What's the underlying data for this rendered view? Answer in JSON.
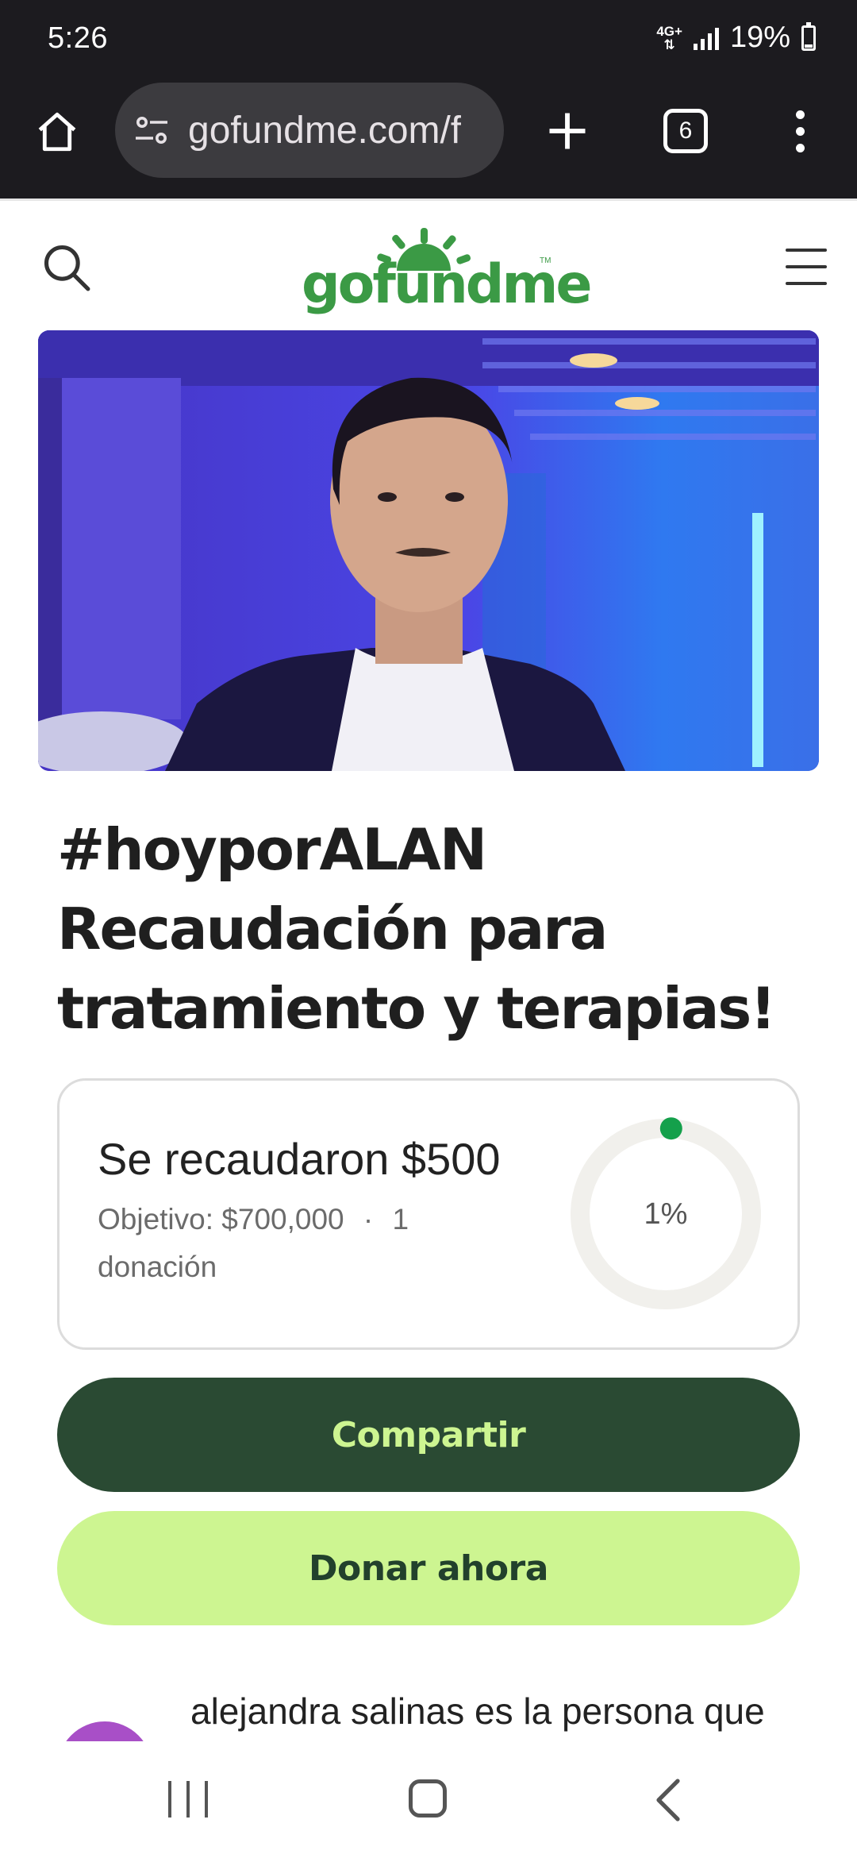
{
  "status_bar": {
    "time": "5:26",
    "network": "4G+",
    "battery": "19%"
  },
  "browser": {
    "url": "gofundme.com/f",
    "tab_count": "6",
    "icons": [
      "home-icon",
      "tune-icon",
      "plus-icon",
      "tabs-icon",
      "more-vert-icon"
    ]
  },
  "site": {
    "logo": "gofundme",
    "icons": [
      "search-icon",
      "menu-icon"
    ]
  },
  "campaign": {
    "title": "#hoyporALAN Recaudación para tratamiento y terapias!",
    "raised": "Se recaudaron $500",
    "goal": "Objetivo: $700,000",
    "separator": "·",
    "donations": "1 donación",
    "progress_label": "1%",
    "progress_fraction": 0.01
  },
  "actions": {
    "share": "Compartir",
    "donate": "Donar ahora"
  },
  "organizer": {
    "text": "alejandra salinas es la persona que"
  },
  "colors": {
    "brand_green": "#3b9a45",
    "share_bg": "#2a4a33",
    "share_text": "#cdf591",
    "donate_bg": "#cdf591",
    "donate_text": "#22412c",
    "progress_dot": "#14a04b",
    "avatar": "#a84fc7"
  }
}
